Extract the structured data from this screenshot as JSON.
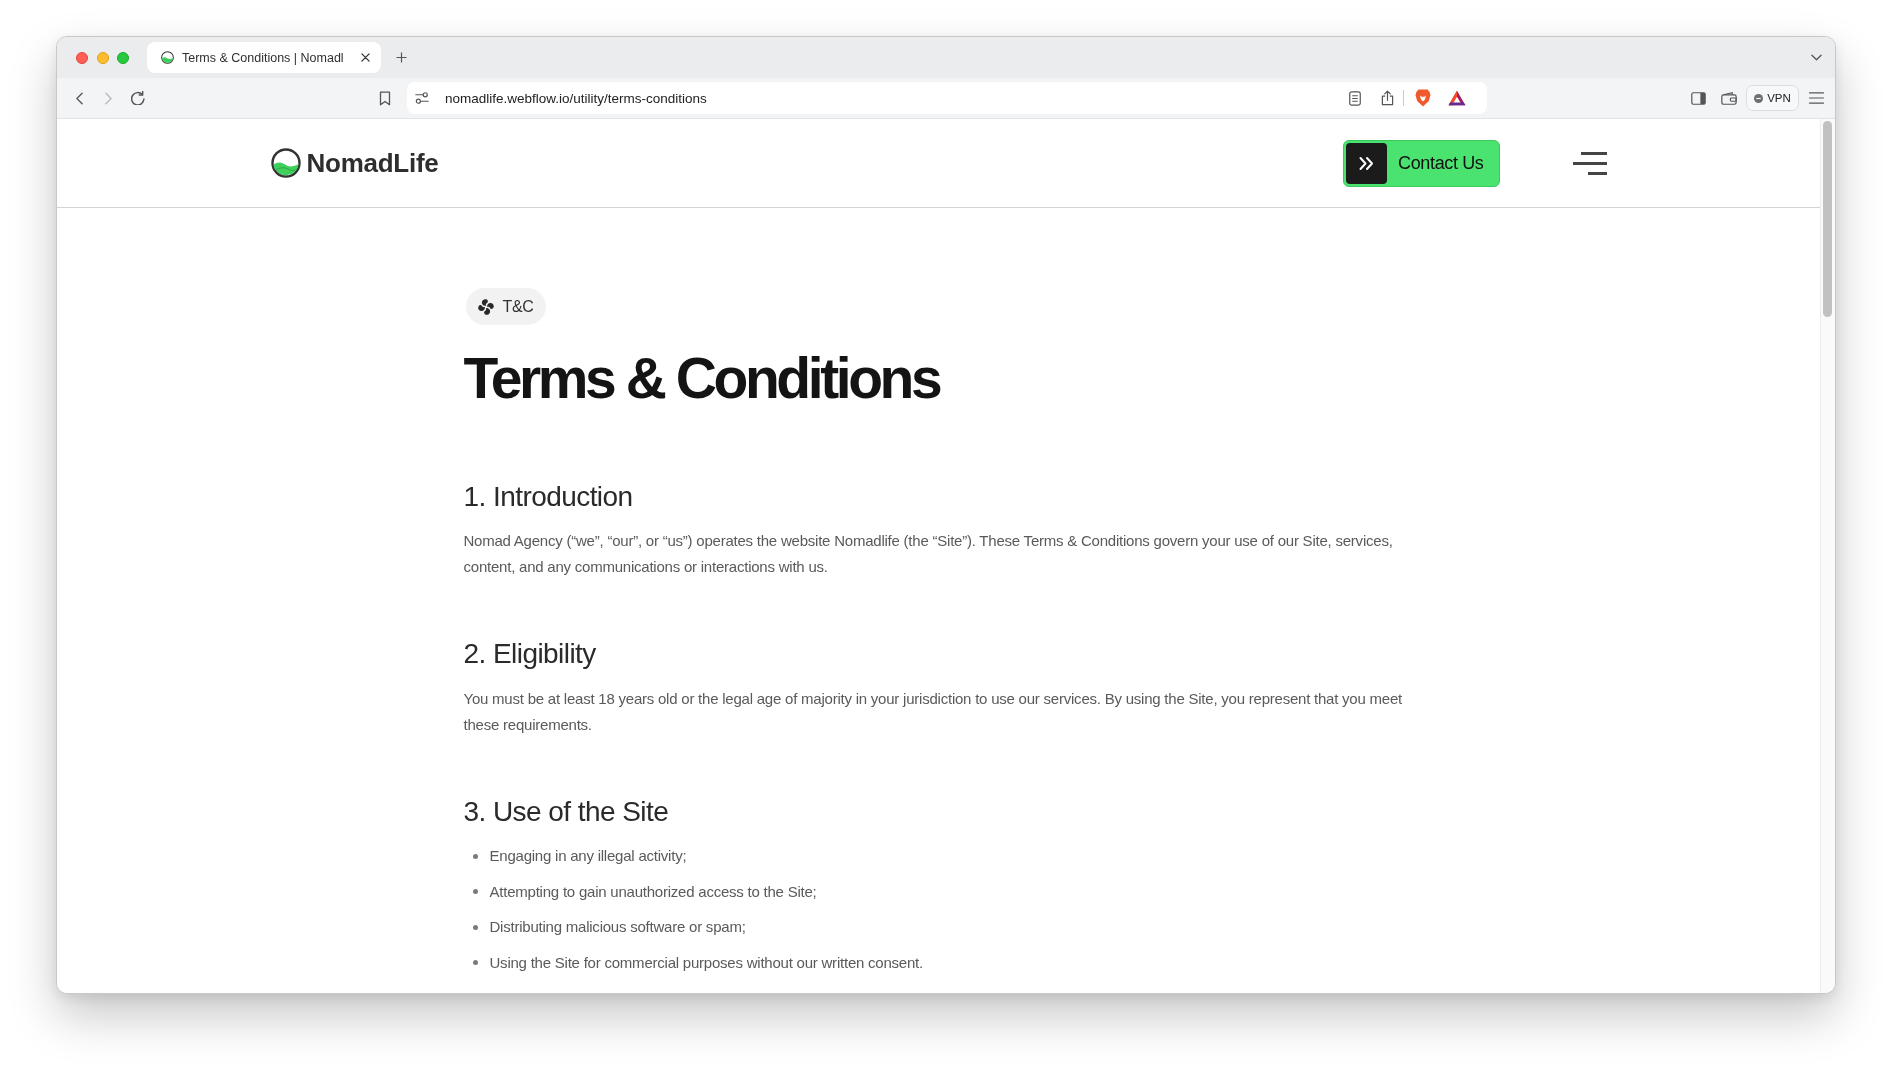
{
  "browser": {
    "tab": {
      "title": "Terms & Conditions | Nomadl"
    },
    "forward_disabled": true,
    "address_bar": {
      "url": "nomadlife.webflow.io/utility/terms-conditions"
    },
    "vpn_button": {
      "label": "VPN"
    }
  },
  "header": {
    "logo": {
      "text": "NomadLife"
    },
    "contact_button": {
      "label": "Contact Us"
    }
  },
  "badge": {
    "label": "T&C"
  },
  "title": "Terms & Conditions",
  "sections": [
    {
      "kind": "paragraph",
      "heading": "1. Introduction",
      "body": "Nomad Agency (“we”, “our”, or “us”) operates the website Nomadlife (the “Site”). These Terms & Conditions govern your use of our Site, services, content, and any communications or interactions with us."
    },
    {
      "kind": "paragraph",
      "heading": "2. Eligibility",
      "body": "You must be at least 18 years old or the legal age of majority in your jurisdiction to use our services. By using the Site, you represent that you meet these requirements."
    },
    {
      "kind": "list",
      "heading": "3. Use of the Site",
      "items": [
        "Engaging in any illegal activity;",
        "Attempting to gain unauthorized access to the Site;",
        "Distributing malicious software or spam;",
        "Using the Site for commercial purposes without our written consent."
      ]
    }
  ]
}
